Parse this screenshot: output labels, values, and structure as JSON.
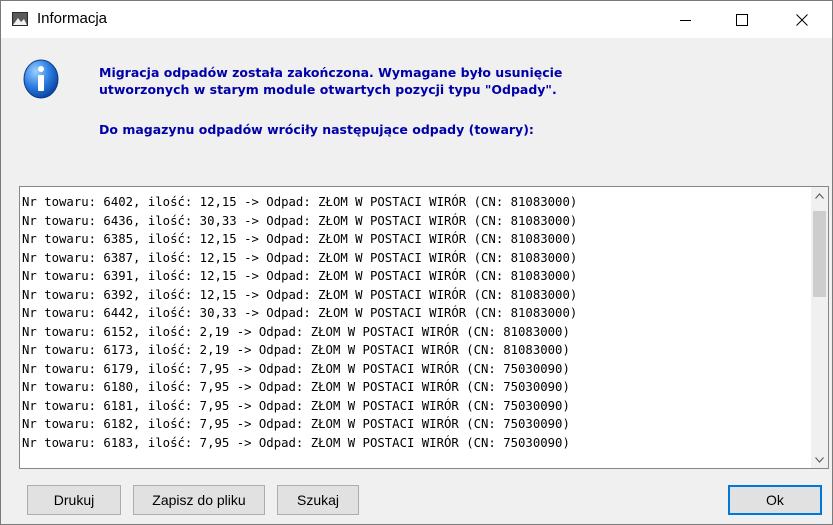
{
  "window": {
    "title": "Informacja",
    "controls": {
      "minimize": "—",
      "maximize": "☐",
      "close": "✕"
    }
  },
  "message": {
    "text": "Migracja odpadów została zakończona. Wymagane było usunięcie\nutworzonych w starym module otwartych pozycji typu \"Odpady\".",
    "subtext": "Do magazynu odpadów wróciły następujące odpady (towary):",
    "color": "#0000aa"
  },
  "list": {
    "lines": [
      "Nr towaru: 6402, ilość: 12,15 -> Odpad: ZŁOM W POSTACI WIRÓR (CN: 81083000)",
      "Nr towaru: 6436, ilość: 30,33 -> Odpad: ZŁOM W POSTACI WIRÓR (CN: 81083000)",
      "Nr towaru: 6385, ilość: 12,15 -> Odpad: ZŁOM W POSTACI WIRÓR (CN: 81083000)",
      "Nr towaru: 6387, ilość: 12,15 -> Odpad: ZŁOM W POSTACI WIRÓR (CN: 81083000)",
      "Nr towaru: 6391, ilość: 12,15 -> Odpad: ZŁOM W POSTACI WIRÓR (CN: 81083000)",
      "Nr towaru: 6392, ilość: 12,15 -> Odpad: ZŁOM W POSTACI WIRÓR (CN: 81083000)",
      "Nr towaru: 6442, ilość: 30,33 -> Odpad: ZŁOM W POSTACI WIRÓR (CN: 81083000)",
      "Nr towaru: 6152, ilość: 2,19 -> Odpad: ZŁOM W POSTACI WIRÓR (CN: 81083000)",
      "Nr towaru: 6173, ilość: 2,19 -> Odpad: ZŁOM W POSTACI WIRÓR (CN: 81083000)",
      "Nr towaru: 6179, ilość: 7,95 -> Odpad: ZŁOM W POSTACI WIRÓR (CN: 75030090)",
      "Nr towaru: 6180, ilość: 7,95 -> Odpad: ZŁOM W POSTACI WIRÓR (CN: 75030090)",
      "Nr towaru: 6181, ilość: 7,95 -> Odpad: ZŁOM W POSTACI WIRÓR (CN: 75030090)",
      "Nr towaru: 6182, ilość: 7,95 -> Odpad: ZŁOM W POSTACI WIRÓR (CN: 75030090)",
      "Nr towaru: 6183, ilość: 7,95 -> Odpad: ZŁOM W POSTACI WIRÓR (CN: 75030090)"
    ]
  },
  "buttons": {
    "print": "Drukuj",
    "save": "Zapisz do pliku",
    "search": "Szukaj",
    "ok": "Ok"
  },
  "icons": {
    "app": "app-icon",
    "info": "info-icon",
    "scroll_up": "chevron-up-icon",
    "scroll_down": "chevron-down-icon"
  },
  "colors": {
    "accent": "#0078d7",
    "info_blue": "#1e6fd0"
  }
}
